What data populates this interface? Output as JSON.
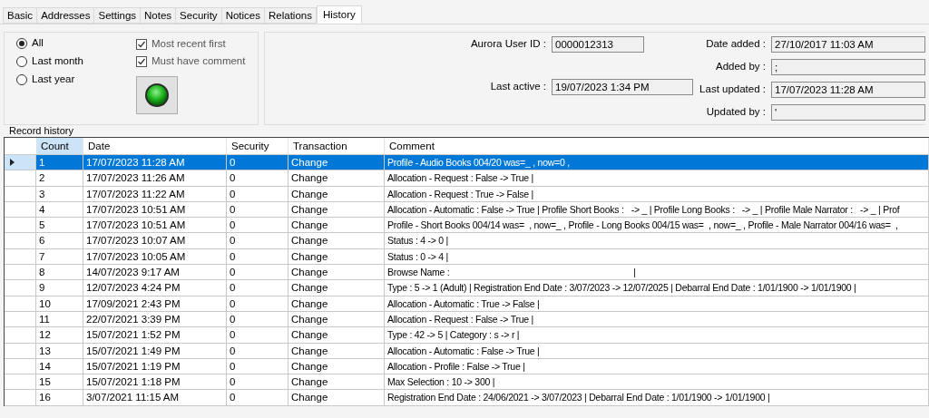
{
  "tabs": [
    {
      "label": "Basic",
      "selected": false
    },
    {
      "label": "Addresses",
      "selected": false
    },
    {
      "label": "Settings",
      "selected": false
    },
    {
      "label": "Notes",
      "selected": false
    },
    {
      "label": "Security",
      "selected": false
    },
    {
      "label": "Notices",
      "selected": false
    },
    {
      "label": "Relations",
      "selected": false
    },
    {
      "label": "History",
      "selected": true
    }
  ],
  "filters": {
    "periods": [
      {
        "label": "All",
        "selected": true
      },
      {
        "label": "Last month",
        "selected": false
      },
      {
        "label": "Last year",
        "selected": false
      }
    ],
    "options": [
      {
        "label": "Most recent first",
        "checked": true
      },
      {
        "label": "Must have comment",
        "checked": true
      }
    ]
  },
  "info": {
    "user_id_label": "Aurora User ID :",
    "user_id": "0000012313",
    "last_active_label": "Last active :",
    "last_active": "19/07/2023 1:34 PM",
    "date_added_label": "Date added :",
    "date_added": "27/10/2017 11:03 AM",
    "added_by_label": "Added by :",
    "added_by": ";",
    "last_updated_label": "Last updated :",
    "last_updated": "17/07/2023 11:28 AM",
    "updated_by_label": "Updated by :",
    "updated_by": "'"
  },
  "history": {
    "title": "Record history",
    "columns": [
      "Count",
      "Date",
      "Security",
      "Transaction",
      "Comment"
    ],
    "rows": [
      {
        "count": "1",
        "date": "17/07/2023 11:28 AM",
        "security": "0",
        "transaction": "Change",
        "comment": "Profile - Audio Books 004/20 was=_ , now=0 ,",
        "selected": true
      },
      {
        "count": "2",
        "date": "17/07/2023 11:26 AM",
        "security": "0",
        "transaction": "Change",
        "comment": "Allocation - Request : False -> True |",
        "selected": false
      },
      {
        "count": "3",
        "date": "17/07/2023 11:22 AM",
        "security": "0",
        "transaction": "Change",
        "comment": "Allocation - Request : True -> False |",
        "selected": false
      },
      {
        "count": "4",
        "date": "17/07/2023 10:51 AM",
        "security": "0",
        "transaction": "Change",
        "comment": "Allocation - Automatic : False -> True | Profile Short Books :   -> _ | Profile Long Books :   -> _ | Profile Male Narrator :   -> _ | Prof",
        "selected": false
      },
      {
        "count": "5",
        "date": "17/07/2023 10:51 AM",
        "security": "0",
        "transaction": "Change",
        "comment": "Profile - Short Books 004/14 was=  , now=_ , Profile - Long Books 004/15 was=  , now=_ , Profile - Male Narrator 004/16 was=  ,",
        "selected": false
      },
      {
        "count": "6",
        "date": "17/07/2023 10:07 AM",
        "security": "0",
        "transaction": "Change",
        "comment": "Status : 4 -> 0 |",
        "selected": false
      },
      {
        "count": "7",
        "date": "17/07/2023 10:05 AM",
        "security": "0",
        "transaction": "Change",
        "comment": "Status : 0 -> 4 |",
        "selected": false
      },
      {
        "count": "8",
        "date": "14/07/2023 9:17 AM",
        "security": "0",
        "transaction": "Change",
        "comment": "Browse Name :                                                                            |",
        "selected": false
      },
      {
        "count": "9",
        "date": "12/07/2023 4:24 PM",
        "security": "0",
        "transaction": "Change",
        "comment": "Type : 5 -> 1 (Adult) | Registration End Date : 3/07/2023 -> 12/07/2025 | Debarral End Date : 1/01/1900 -> 1/01/1900 |",
        "selected": false
      },
      {
        "count": "10",
        "date": "17/09/2021 2:43 PM",
        "security": "0",
        "transaction": "Change",
        "comment": "Allocation - Automatic : True -> False |",
        "selected": false
      },
      {
        "count": "11",
        "date": "22/07/2021 3:39 PM",
        "security": "0",
        "transaction": "Change",
        "comment": "Allocation - Request : False -> True |",
        "selected": false
      },
      {
        "count": "12",
        "date": "15/07/2021 1:52 PM",
        "security": "0",
        "transaction": "Change",
        "comment": "Type : 42 -> 5 | Category : s -> r |",
        "selected": false
      },
      {
        "count": "13",
        "date": "15/07/2021 1:49 PM",
        "security": "0",
        "transaction": "Change",
        "comment": "Allocation - Automatic : False -> True |",
        "selected": false
      },
      {
        "count": "14",
        "date": "15/07/2021 1:19 PM",
        "security": "0",
        "transaction": "Change",
        "comment": "Allocation - Profile : False -> True |",
        "selected": false
      },
      {
        "count": "15",
        "date": "15/07/2021 1:18 PM",
        "security": "0",
        "transaction": "Change",
        "comment": "Max Selection : 10 -> 300 |",
        "selected": false
      },
      {
        "count": "16",
        "date": "3/07/2021 11:15 AM",
        "security": "0",
        "transaction": "Change",
        "comment": "Registration End Date : 24/06/2021 -> 3/07/2023 | Debarral End Date : 1/01/1900 -> 1/01/1900 |",
        "selected": false
      }
    ]
  }
}
